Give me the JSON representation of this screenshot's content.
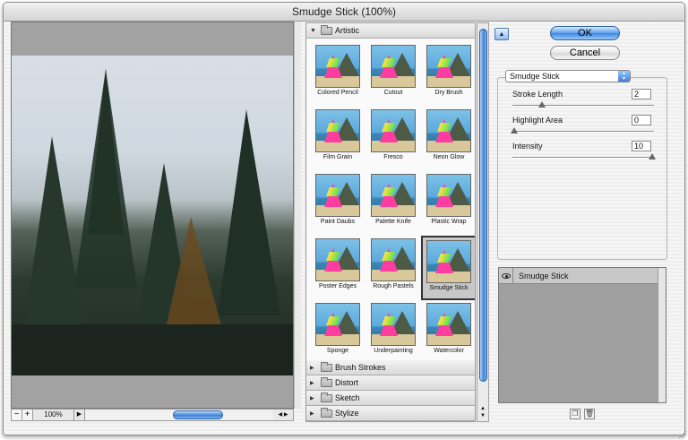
{
  "window": {
    "title": "Smudge Stick (100%)"
  },
  "preview": {
    "zoom_out": "−",
    "zoom_in": "+",
    "zoom_level": "100%"
  },
  "gallery": {
    "open_category": "Artistic",
    "filters": [
      {
        "label": "Colored Pencil"
      },
      {
        "label": "Cutout"
      },
      {
        "label": "Dry Brush"
      },
      {
        "label": "Film Grain"
      },
      {
        "label": "Fresco"
      },
      {
        "label": "Neon Glow"
      },
      {
        "label": "Paint Daubs"
      },
      {
        "label": "Palette Knife"
      },
      {
        "label": "Plastic Wrap"
      },
      {
        "label": "Poster Edges"
      },
      {
        "label": "Rough Pastels"
      },
      {
        "label": "Smudge Stick"
      },
      {
        "label": "Sponge"
      },
      {
        "label": "Underpainting"
      },
      {
        "label": "Watercolor"
      }
    ],
    "selected_filter": "Smudge Stick",
    "closed_categories": [
      "Brush Strokes",
      "Distort",
      "Sketch",
      "Stylize"
    ]
  },
  "buttons": {
    "ok": "OK",
    "cancel": "Cancel"
  },
  "settings": {
    "filter_select": "Smudge Stick",
    "params": [
      {
        "label": "Stroke Length",
        "value": "2",
        "fraction": 0.2
      },
      {
        "label": "Highlight Area",
        "value": "0",
        "fraction": 0.0
      },
      {
        "label": "Intensity",
        "value": "10",
        "fraction": 1.0
      }
    ]
  },
  "layers": {
    "items": [
      {
        "name": "Smudge Stick"
      }
    ]
  },
  "colors": {
    "accent": "#3c86e0",
    "selected_cell": "#c8c8c8"
  },
  "icons": {
    "new_layer": "new-layer-icon",
    "delete_layer": "trash-icon",
    "visibility": "eye-icon"
  }
}
